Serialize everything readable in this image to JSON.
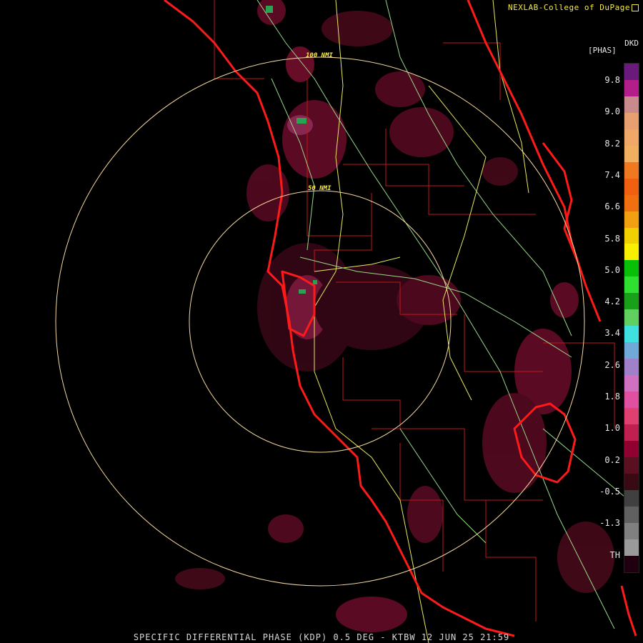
{
  "header": {
    "credit": "NEXLAB-College of DuPage"
  },
  "footer": {
    "caption": "SPECIFIC DIFFERENTIAL PHASE (KDP) 0.5 DEG - KTBW 12 JUN 25 21:59"
  },
  "rings": {
    "inner_label": "50 NMI",
    "outer_label": "100 NMI"
  },
  "legend": {
    "product_code": "DKD",
    "units": "[PHAS]",
    "ticks": [
      "9.8",
      "9.0",
      "8.2",
      "7.4",
      "6.6",
      "5.8",
      "5.0",
      "4.2",
      "3.4",
      "2.6",
      "1.8",
      "1.0",
      "0.2",
      "-0.5",
      "-1.3",
      "TH"
    ],
    "colors": [
      "#6a1a7a",
      "#b41e8a",
      "#c88a8a",
      "#e8a070",
      "#f0a868",
      "#f0b060",
      "#f07820",
      "#f06010",
      "#f07010",
      "#f0a010",
      "#f0d000",
      "#f8f000",
      "#08c008",
      "#30e030",
      "#18a018",
      "#60d060",
      "#40e0e0",
      "#70a8d8",
      "#a080c8",
      "#d070c0",
      "#e050a0",
      "#e04070",
      "#c02050",
      "#900030",
      "#5a1020",
      "#3a0a14",
      "#404040",
      "#606060",
      "#808080",
      "#9a9a9a",
      "#200010"
    ]
  }
}
